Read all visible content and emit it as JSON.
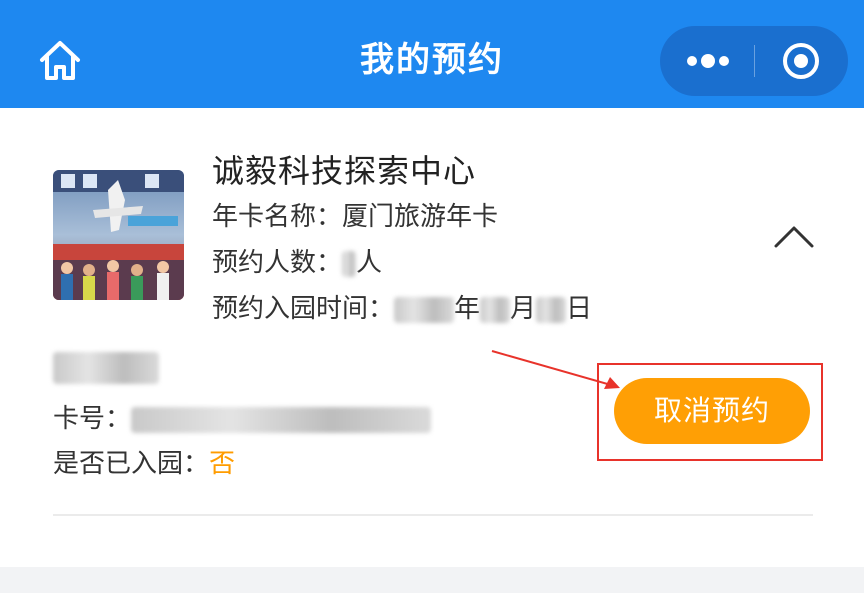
{
  "header": {
    "title": "我的预约",
    "home_icon": "home-icon",
    "more_icon": "more-icon",
    "close_icon": "target-icon",
    "color": "#1e88f0"
  },
  "reservation": {
    "venue_name": "诚毅科技探索中心",
    "card_label": "年卡名称：",
    "card_name": "厦门旅游年卡",
    "people_label": "预约人数：",
    "people_unit": "人",
    "date_label": "预约入园时间：",
    "date_year_unit": "年",
    "date_month_unit": "月",
    "date_day_unit": "日",
    "card_no_label": "卡号：",
    "entered_label": "是否已入园：",
    "entered_value": "否",
    "cancel_label": "取消预约",
    "accent_color": "#ff9f05",
    "highlight_color": "#e8332b"
  }
}
